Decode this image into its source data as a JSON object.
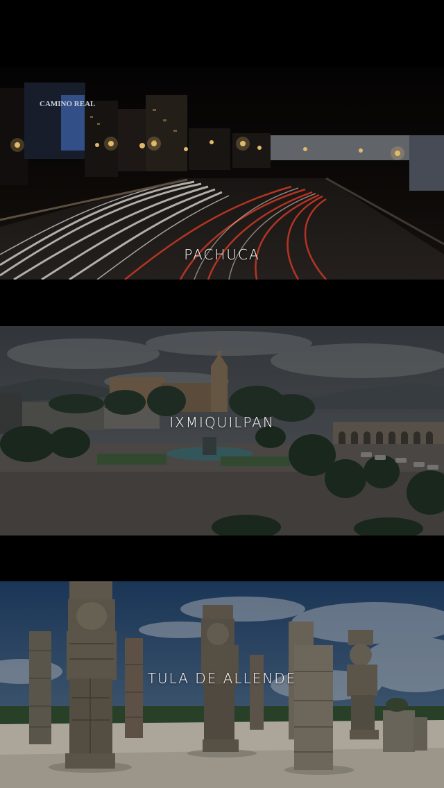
{
  "cities": [
    {
      "name": "PACHUCA"
    },
    {
      "name": "IXMIQUILPAN"
    },
    {
      "name": "TULA DE ALLENDE"
    }
  ],
  "signage": {
    "hotel_sign": "CAMINO REAL"
  },
  "colors": {
    "background": "#000000",
    "label": "#ffffff"
  }
}
